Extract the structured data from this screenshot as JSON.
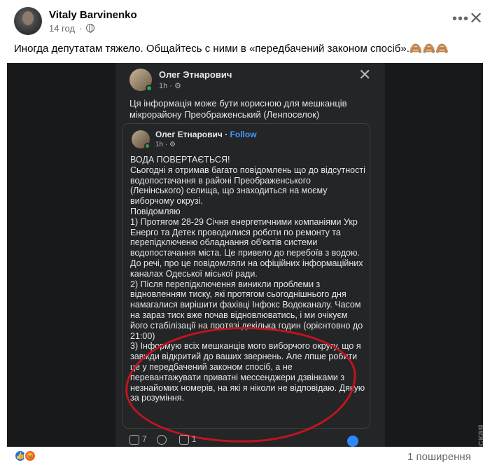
{
  "post": {
    "author": "Vitaly Barvinenko",
    "time": "14 год",
    "text": "Иногда депутатам тяжело. Общайтесь с ними в «передбачений законом спосіб».🙈🙈🙈",
    "more_icon": "more-dots-icon",
    "close_icon": "close-icon"
  },
  "screenshot": {
    "author": "Олег Этнарович",
    "time": "1h · ⚙",
    "intro": "Ця інформація може бути корисною для мешканців мікрорайону Преображенський (Ленпоселок)",
    "shared": {
      "author": "Олег Етнарович",
      "follow": "Follow",
      "time": "1h · ⚙",
      "body": "ВОДА ПОВЕРТАЄТЬСЯ!\nСьогодні я отримав багато повідомлень що до відсутності водопостачання в районі Преображенського (Ленінського) селища, що знаходиться на моєму виборчому окрузі.\nПовідомляю\n1) Протягом  28-29 Січня енергетичними компаніями Укр Енерго та Детек проводилися роботи по ремонту та перепідключеню обладнання об'єктів системи водопостачання міста. Це привело до перебоїв з водою. До речі, про це повідомляли на офіційних інформаційних каналах Одеської міської ради.\n2) Після перепідключення виникли проблеми з відновленням тиску, які протягом сьогоднішнього дня намагалися вирішити фахівці Інфокс Водоканалу. Часом на зараз тиск вже почав відновлюватись, і ми очікуєм його стабілізації на протязі декілька годин (орієнтовно до 21:00)\n3) Інформую всіх мешканців мого виборчого округу, що я завжди відкритий до ваших звернень. Але лпше робити це у передбачений законом спосіб, а не перевантажувати приватні мессенджери дзвінками з незнайомих номерів, на які я ніколи не відповідаю. Дякую за розуміння."
    },
    "likes": "7",
    "shares_count": "1",
    "watermark": "Думская"
  },
  "footer": {
    "shares": "1 поширення"
  },
  "colors": {
    "link_blue": "#4599ff",
    "annotation_red": "#c0141f"
  }
}
